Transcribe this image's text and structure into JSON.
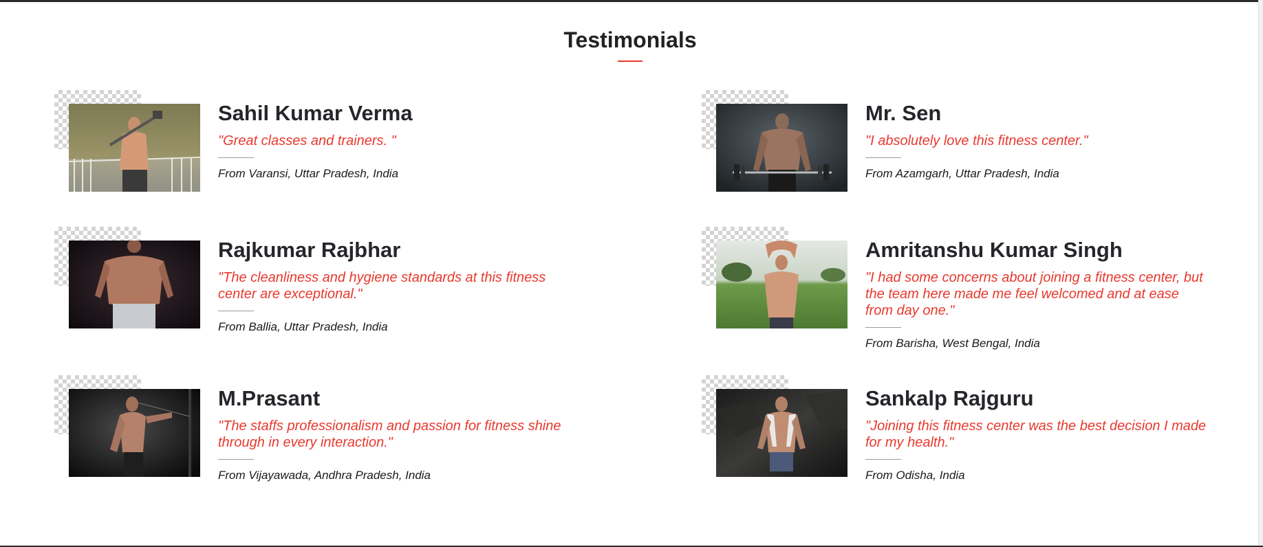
{
  "section": {
    "title": "Testimonials"
  },
  "colors": {
    "accent": "#e8392e",
    "heading": "#24262a",
    "text": "#1a1a1a"
  },
  "testimonials": [
    {
      "name": "Sahil Kumar Verma",
      "quote": "\"Great classes and trainers. \"",
      "location": "From Varansi, Uttar Pradesh, India",
      "photo_subject": "shirtless man holding sledgehammer outdoors"
    },
    {
      "name": "Mr. Sen",
      "quote": "\"I absolutely love this fitness center.\"",
      "location": "From Azamgarh, Uttar Pradesh, India",
      "photo_subject": "bodybuilder lifting barbell in dark studio"
    },
    {
      "name": "Rajkumar Rajbhar",
      "quote": "\"The cleanliness and hygiene standards at this fitness center are exceptional.\"",
      "location": "From Ballia, Uttar Pradesh, India",
      "photo_subject": "muscular man posing on dark background"
    },
    {
      "name": "Amritanshu Kumar Singh",
      "quote": "\"I had some concerns about joining a fitness center, but the team here made me feel welcomed and at ease from day one.\"",
      "location": "From Barisha, West Bengal, India",
      "photo_subject": "shirtless man posing in green field"
    },
    {
      "name": "M.Prasant",
      "quote": "\"The staffs professionalism and passion for fitness shine through in every interaction.\"",
      "location": "From Vijayawada, Andhra Pradesh, India",
      "photo_subject": "athlete doing cable workout in dark gym"
    },
    {
      "name": "Sankalp Rajguru",
      "quote": "\"Joining this fitness center was the best decision I made for my health.\"",
      "location": "From Odisha, India",
      "photo_subject": "man with towel against dark marble wall"
    }
  ]
}
